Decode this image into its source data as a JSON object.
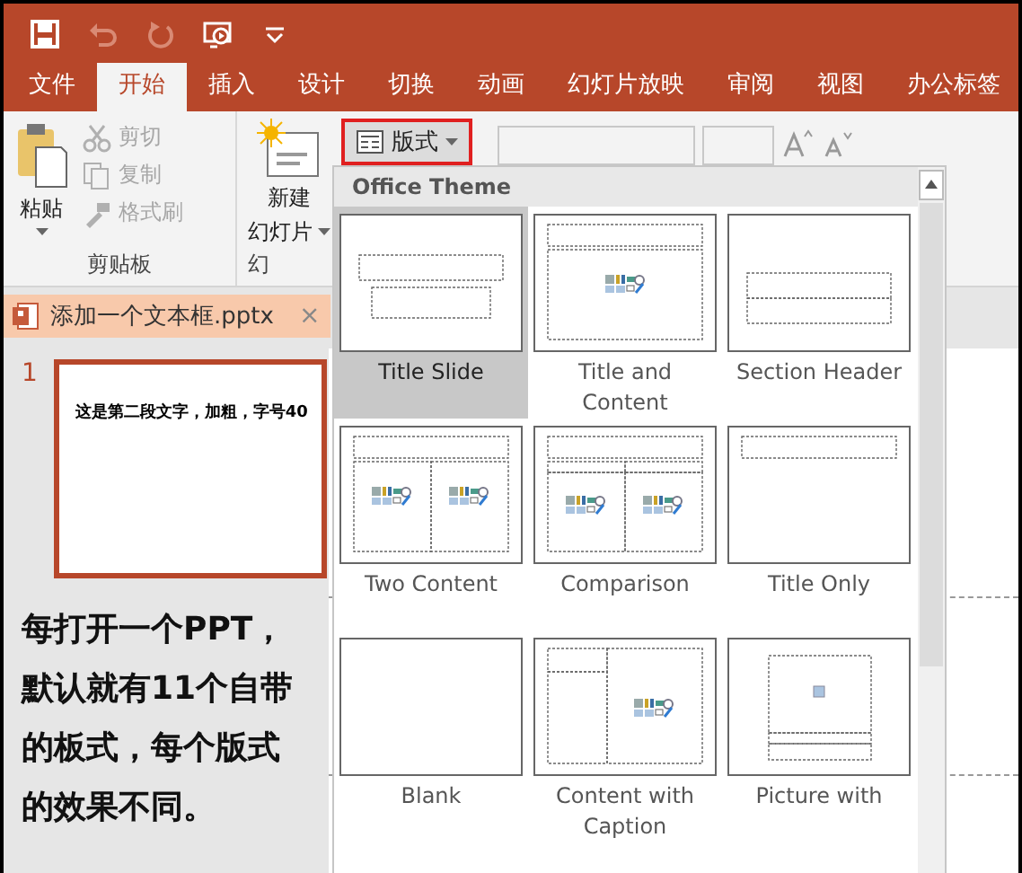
{
  "quick_access": [
    {
      "kind": "save",
      "disabled": false
    },
    {
      "kind": "undo",
      "disabled": true
    },
    {
      "kind": "redo",
      "disabled": true
    },
    {
      "kind": "present",
      "disabled": false
    },
    {
      "kind": "customize",
      "disabled": false
    }
  ],
  "tabs": [
    {
      "label": "文件",
      "selected": false
    },
    {
      "label": "开始",
      "selected": true
    },
    {
      "label": "插入",
      "selected": false
    },
    {
      "label": "设计",
      "selected": false
    },
    {
      "label": "切换",
      "selected": false
    },
    {
      "label": "动画",
      "selected": false
    },
    {
      "label": "幻灯片放映",
      "selected": false
    },
    {
      "label": "审阅",
      "selected": false
    },
    {
      "label": "视图",
      "selected": false
    },
    {
      "label": "办公标签",
      "selected": false
    }
  ],
  "ribbon": {
    "clipboard": {
      "paste": "粘贴",
      "items": [
        {
          "kind": "cut",
          "label": "剪切",
          "disabled": true
        },
        {
          "kind": "copy",
          "label": "复制",
          "disabled": true
        },
        {
          "kind": "format-painter",
          "label": "格式刷",
          "disabled": true
        }
      ],
      "group_label": "剪贴板"
    },
    "slides": {
      "new_slide": [
        "新建",
        "幻灯片"
      ],
      "layout_button": {
        "label": "版式",
        "highlighted": true
      },
      "group_label": "幻"
    }
  },
  "document_tab": {
    "title": "添加一个文本框.pptx",
    "close": "×"
  },
  "slides": [
    {
      "number": "1",
      "selected": true,
      "text": "这是第二段文字，加粗，字号40"
    }
  ],
  "note": "每打开一个PPT，默认就有11个自带的板式，每个版式的效果不同。",
  "layout_gallery": {
    "heading": "Office Theme",
    "layouts": [
      {
        "name": "Title Slide",
        "kind": "title",
        "selected": true
      },
      {
        "name": "Title and Content",
        "kind": "title-content",
        "selected": false
      },
      {
        "name": "Section Header",
        "kind": "section",
        "selected": false
      },
      {
        "name": "Two Content",
        "kind": "two-content",
        "selected": false
      },
      {
        "name": "Comparison",
        "kind": "comparison",
        "selected": false
      },
      {
        "name": "Title Only",
        "kind": "title-only",
        "selected": false
      },
      {
        "name": "Blank",
        "kind": "blank",
        "selected": false
      },
      {
        "name": "Content with Caption",
        "kind": "content-caption",
        "selected": false
      },
      {
        "name": "Picture with",
        "kind": "picture-caption",
        "selected": false
      }
    ]
  }
}
